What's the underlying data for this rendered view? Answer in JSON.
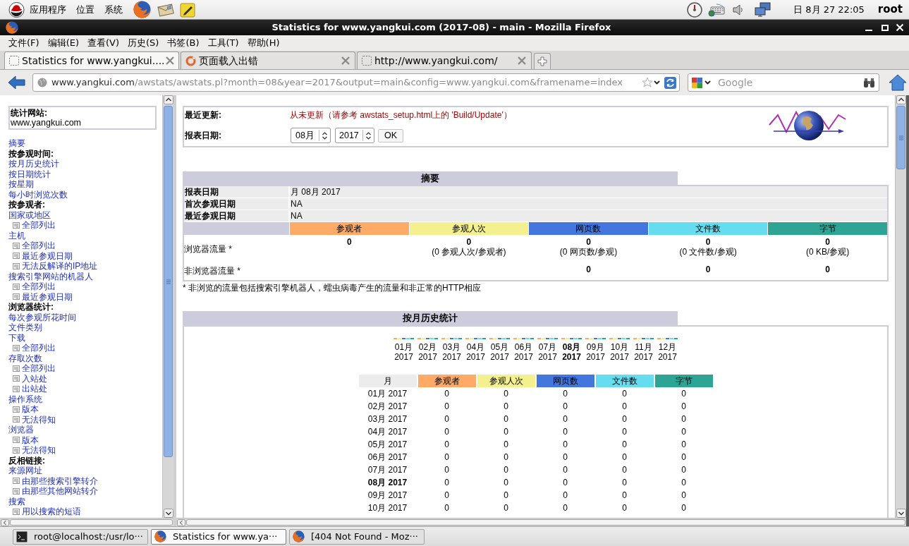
{
  "top_panel": {
    "menus": [
      "应用程序",
      "位置",
      "系统"
    ],
    "clock": "日 8月 27 22:05",
    "user": "root"
  },
  "window": {
    "title": "Statistics for www.yangkui.com (2017-08) - main - Mozilla Firefox"
  },
  "menu_bar": [
    "文件(F)",
    "编辑(E)",
    "查看(V)",
    "历史(S)",
    "书签(B)",
    "工具(T)",
    "帮助(H)"
  ],
  "tabs": [
    {
      "label": "Statistics for www.yangkui....",
      "kind": "page",
      "selected": true
    },
    {
      "label": "页面载入出错",
      "kind": "error",
      "selected": false
    },
    {
      "label": "http://www.yangkui.com/",
      "kind": "page",
      "selected": false
    }
  ],
  "address_bar": {
    "host": "www.yangkui.com",
    "path": "/awstats/awstats.pl?month=08&year=2017&output=main&config=www.yangkui.com&framename=index"
  },
  "search": {
    "placeholder": "Google"
  },
  "sidebar": {
    "site_label": "统计网站:",
    "site": "www.yangkui.com",
    "items": [
      {
        "kind": "link",
        "label": "摘要"
      },
      {
        "kind": "heading",
        "label": "按参观时间:"
      },
      {
        "kind": "link",
        "label": "按月历史统计"
      },
      {
        "kind": "link",
        "label": "按日期统计"
      },
      {
        "kind": "link",
        "label": "按星期"
      },
      {
        "kind": "link",
        "label": "每小时浏览次数"
      },
      {
        "kind": "heading",
        "label": "按参观者:"
      },
      {
        "kind": "link",
        "label": "国家或地区",
        "children": [
          {
            "label": "全部列出"
          }
        ]
      },
      {
        "kind": "link",
        "label": "主机",
        "children": [
          {
            "label": "全部列出"
          },
          {
            "label": "最近参观日期"
          },
          {
            "label": "无法反解译的IP地址"
          }
        ]
      },
      {
        "kind": "link",
        "label": "搜索引擎网站的机器人",
        "children": [
          {
            "label": "全部列出"
          },
          {
            "label": "最近参观日期"
          }
        ]
      },
      {
        "kind": "heading",
        "label": "浏览器统计:"
      },
      {
        "kind": "link",
        "label": "每次参观所花时间"
      },
      {
        "kind": "link",
        "label": "文件类别"
      },
      {
        "kind": "link",
        "label": "下载",
        "children": [
          {
            "label": "全部列出"
          }
        ]
      },
      {
        "kind": "link",
        "label": "存取次数",
        "children": [
          {
            "label": "全部列出"
          },
          {
            "label": "入站处"
          },
          {
            "label": "出站处"
          }
        ]
      },
      {
        "kind": "link",
        "label": "操作系统",
        "children": [
          {
            "label": "版本"
          },
          {
            "label": "无法得知"
          }
        ]
      },
      {
        "kind": "link",
        "label": "浏览器",
        "children": [
          {
            "label": "版本"
          },
          {
            "label": "无法得知"
          }
        ]
      },
      {
        "kind": "heading",
        "label": "反相链接:"
      },
      {
        "kind": "link",
        "label": "来源网址",
        "children": [
          {
            "label": "由那些搜索引擎转介"
          },
          {
            "label": "由那些其他网站转介"
          }
        ]
      },
      {
        "kind": "link",
        "label": "搜索",
        "children": [
          {
            "label": "用以搜索的短语"
          }
        ]
      }
    ]
  },
  "header": {
    "last_update": {
      "label": "最近更新:",
      "value": "从未更新（请参考 awstats_setup.html上的 'Build/Update'）"
    },
    "report_date": {
      "label": "报表日期:",
      "month": "08月",
      "year": "2017",
      "button": "OK"
    }
  },
  "summary": {
    "title": "摘要",
    "info": [
      {
        "label": "报表日期",
        "value": "月 08月 2017"
      },
      {
        "label": "首次参观日期",
        "value": "NA"
      },
      {
        "label": "最近参观日期",
        "value": "NA"
      }
    ],
    "columns": [
      {
        "label": "参观者",
        "color": "#ffaa66"
      },
      {
        "label": "参观人次",
        "color": "#f4f090"
      },
      {
        "label": "网页数",
        "color": "#4477dd"
      },
      {
        "label": "文件数",
        "color": "#66ddee"
      },
      {
        "label": "字节",
        "color": "#2ea495"
      }
    ],
    "rows": [
      {
        "label": "浏览器流量 *",
        "cells": [
          {
            "value": "0"
          },
          {
            "value": "0",
            "note": "(0 参观人次/参观者)"
          },
          {
            "value": "0",
            "note": "(0 网页数/参观)"
          },
          {
            "value": "0",
            "note": "(0 文件数/参观)"
          },
          {
            "value": "0",
            "note": "(0 KB/参观)"
          }
        ]
      },
      {
        "label": "非浏览器流量 *",
        "cells": [
          null,
          null,
          {
            "value": "0"
          },
          {
            "value": "0"
          },
          {
            "value": "0"
          }
        ]
      }
    ],
    "footnote": "* 非浏览的流量包括搜索引擎机器人，蠕虫病毒产生的流量和非正常的HTTP相应"
  },
  "monthly": {
    "title": "按月历史统计",
    "chart_months": [
      {
        "month": "01月",
        "year": "2017",
        "selected": false
      },
      {
        "month": "02月",
        "year": "2017",
        "selected": false
      },
      {
        "month": "03月",
        "year": "2017",
        "selected": false
      },
      {
        "month": "04月",
        "year": "2017",
        "selected": false
      },
      {
        "month": "05月",
        "year": "2017",
        "selected": false
      },
      {
        "month": "06月",
        "year": "2017",
        "selected": false
      },
      {
        "month": "07月",
        "year": "2017",
        "selected": false
      },
      {
        "month": "08月",
        "year": "2017",
        "selected": true
      },
      {
        "month": "09月",
        "year": "2017",
        "selected": false
      },
      {
        "month": "10月",
        "year": "2017",
        "selected": false
      },
      {
        "month": "11月",
        "year": "2017",
        "selected": false
      },
      {
        "month": "12月",
        "year": "2017",
        "selected": false
      }
    ],
    "columns": [
      {
        "label": "月"
      },
      {
        "label": "参观者",
        "color": "#ffaa66"
      },
      {
        "label": "参观人次",
        "color": "#f4f090"
      },
      {
        "label": "网页数",
        "color": "#4477dd"
      },
      {
        "label": "文件数",
        "color": "#66ddee"
      },
      {
        "label": "字节",
        "color": "#2ea495"
      }
    ],
    "rows": [
      {
        "month": "01月 2017",
        "values": [
          "0",
          "0",
          "0",
          "0",
          "0"
        ],
        "selected": false
      },
      {
        "month": "02月 2017",
        "values": [
          "0",
          "0",
          "0",
          "0",
          "0"
        ],
        "selected": false
      },
      {
        "month": "03月 2017",
        "values": [
          "0",
          "0",
          "0",
          "0",
          "0"
        ],
        "selected": false
      },
      {
        "month": "04月 2017",
        "values": [
          "0",
          "0",
          "0",
          "0",
          "0"
        ],
        "selected": false
      },
      {
        "month": "05月 2017",
        "values": [
          "0",
          "0",
          "0",
          "0",
          "0"
        ],
        "selected": false
      },
      {
        "month": "06月 2017",
        "values": [
          "0",
          "0",
          "0",
          "0",
          "0"
        ],
        "selected": false
      },
      {
        "month": "07月 2017",
        "values": [
          "0",
          "0",
          "0",
          "0",
          "0"
        ],
        "selected": false
      },
      {
        "month": "08月 2017",
        "values": [
          "0",
          "0",
          "0",
          "0",
          "0"
        ],
        "selected": true
      },
      {
        "month": "09月 2017",
        "values": [
          "0",
          "0",
          "0",
          "0",
          "0"
        ],
        "selected": false
      },
      {
        "month": "10月 2017",
        "values": [
          "0",
          "0",
          "0",
          "0",
          "0"
        ],
        "selected": false
      }
    ]
  },
  "taskbar": [
    {
      "kind": "terminal",
      "label": "root@localhost:/usr/lo···",
      "selected": false
    },
    {
      "kind": "browser",
      "label": "Statistics for www.ya···",
      "selected": true
    },
    {
      "kind": "browser",
      "label": "[404 Not Found - Moz···",
      "selected": false
    }
  ]
}
